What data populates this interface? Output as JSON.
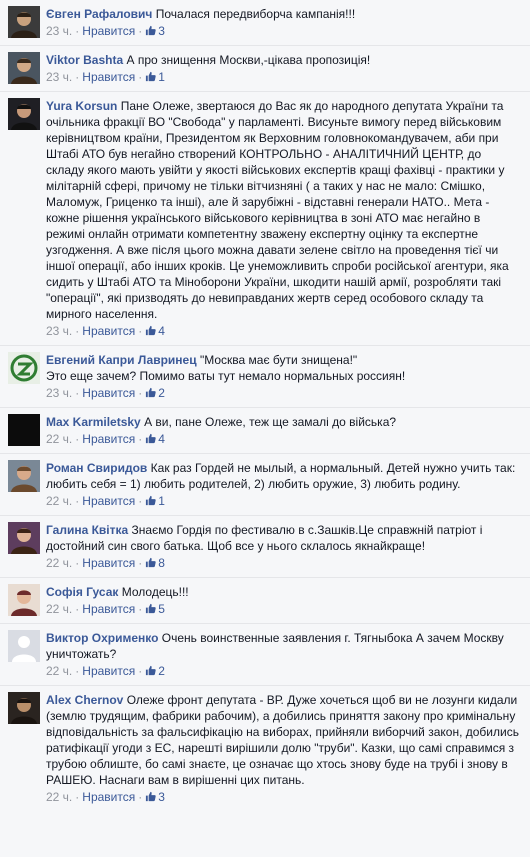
{
  "comments": [
    {
      "author": "Євген Рафалович",
      "text": "Почалася передвиборча кампанія!!!",
      "time": "23 ч.",
      "like": "Нравится",
      "likes": "3",
      "avatar": "avatar-icon"
    },
    {
      "author": "Viktor Bashta",
      "text": "А про знищення Москви,-цікава пропозиція!",
      "time": "23 ч.",
      "like": "Нравится",
      "likes": "1",
      "avatar": "avatar-icon"
    },
    {
      "author": "Yura Korsun",
      "text": "Пане Олеже, звертаюся до Вас як до народного депутата України та очільника фракції ВО \"Свобода\" у парламенті. Висуньте вимогу перед військовим керівництвом країни, Президентом як Верховним головнокомандувачем, аби при Штабі АТО був негайно створений КОНТРОЛЬНО - АНАЛІТИЧНИЙ ЦЕНТР, до складу якого мають увійти у якості військових експертів кращі фахівці - практики у мілітарній сфері, причому не тільки вітчизняні ( а таких у нас не мало: Смішко, Маломуж, Гриценко та інші), але й зарубіжні - відставні генерали НАТО.. Мета - кожне рішення українського військового керівництва в зоні АТО має негайно в режимі онлайн отримати компетентну зважену експертну оцінку та експертне узгодження. А вже після цього можна давати зелене світло на проведення тієї чи іншої операції, або інших кроків. Це унеможливить спроби російської агентури, яка сидить у Штабі АТО та Міноборони України, шкодити нашій армії, розробляти такі \"операції\", які призводять до невиправданих жертв серед особового складу та мирного населення.",
      "time": "23 ч.",
      "like": "Нравится",
      "likes": "4",
      "avatar": "avatar-icon"
    },
    {
      "author": "Евгений Капри Лавринец",
      "text": "\"Москва має бути знищена!\"\nЭто еще зачем? Помимо ваты тут немало нормальных россиян!",
      "time": "23 ч.",
      "like": "Нравится",
      "likes": "2",
      "avatar": "avatar-icon"
    },
    {
      "author": "Max Karmiletsky",
      "text": "А ви, пане Олеже, теж ще замалі до війська?",
      "time": "22 ч.",
      "like": "Нравится",
      "likes": "4",
      "avatar": "avatar-icon"
    },
    {
      "author": "Роман Свиридов",
      "text": "Как раз Гордей не мылый, а нормальный. Детей нужно учить так: любить себя = 1) любить родителей, 2) любить оружие, 3) любить родину.",
      "time": "22 ч.",
      "like": "Нравится",
      "likes": "1",
      "avatar": "avatar-icon"
    },
    {
      "author": "Галина Квітка",
      "text": "Знаємо Гордія по фестивалю в с.Зашків.Це справжній патріот і достойний син свого батька. Щоб все у нього склалось якнайкраще!",
      "time": "22 ч.",
      "like": "Нравится",
      "likes": "8",
      "avatar": "avatar-icon"
    },
    {
      "author": "Софія Гусак",
      "text": "Молодець!!!",
      "time": "22 ч.",
      "like": "Нравится",
      "likes": "5",
      "avatar": "avatar-icon"
    },
    {
      "author": "Виктор Охрименко",
      "text": "Очень воинственные заявления г. Тягныбока А зачем Москву уничтожать?",
      "time": "22 ч.",
      "like": "Нравится",
      "likes": "2",
      "avatar": "avatar-icon"
    },
    {
      "author": "Alex Chernov",
      "text": "Олеже фронт депутата - ВР. Дуже хочеться щоб ви не лозунги кидали (землю трудящим, фабрики рабочим), а добились приняття закону про кримінальну відповідальність за фальсифікацію на виборах, прийняли виборчий закон, добились ратифікації угоди з ЕС, нарешті вирішили долю \"труби\". Казки, що самі справимся з трубою облиште, бо самі знаєте, це означає що хтось знову буде на трубі і знову в РАШЕЮ. Наснаги вам в вирішенні цих питань.",
      "time": "22 ч.",
      "like": "Нравится",
      "likes": "3",
      "avatar": "avatar-icon"
    }
  ],
  "colors": {
    "author": "#3b5998",
    "meta": "#90949c",
    "background": "#f6f7f9",
    "divider": "#e5e6e9"
  },
  "icons": {
    "like_thumb": "thumbs-up-icon",
    "separator": "middle-dot"
  }
}
